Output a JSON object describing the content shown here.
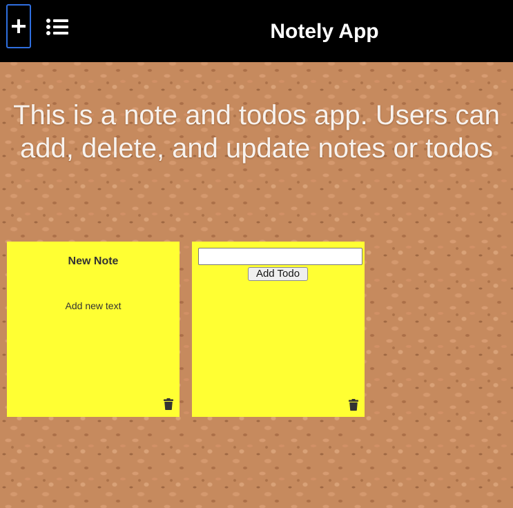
{
  "header": {
    "title": "Notely App",
    "add_icon": "plus-icon",
    "list_icon": "list-icon"
  },
  "main": {
    "description": "This is a note and todos app. Users can add, delete, and update notes or todos"
  },
  "note_card": {
    "title": "New Note",
    "text": "Add new text",
    "delete_icon": "trash-icon"
  },
  "todo_card": {
    "input_value": "",
    "add_button_label": "Add Todo",
    "delete_icon": "trash-icon"
  },
  "colors": {
    "navbar": "#000000",
    "card": "#ffff33",
    "focus_ring": "#2f6fe0",
    "background": "#c68a5e"
  }
}
